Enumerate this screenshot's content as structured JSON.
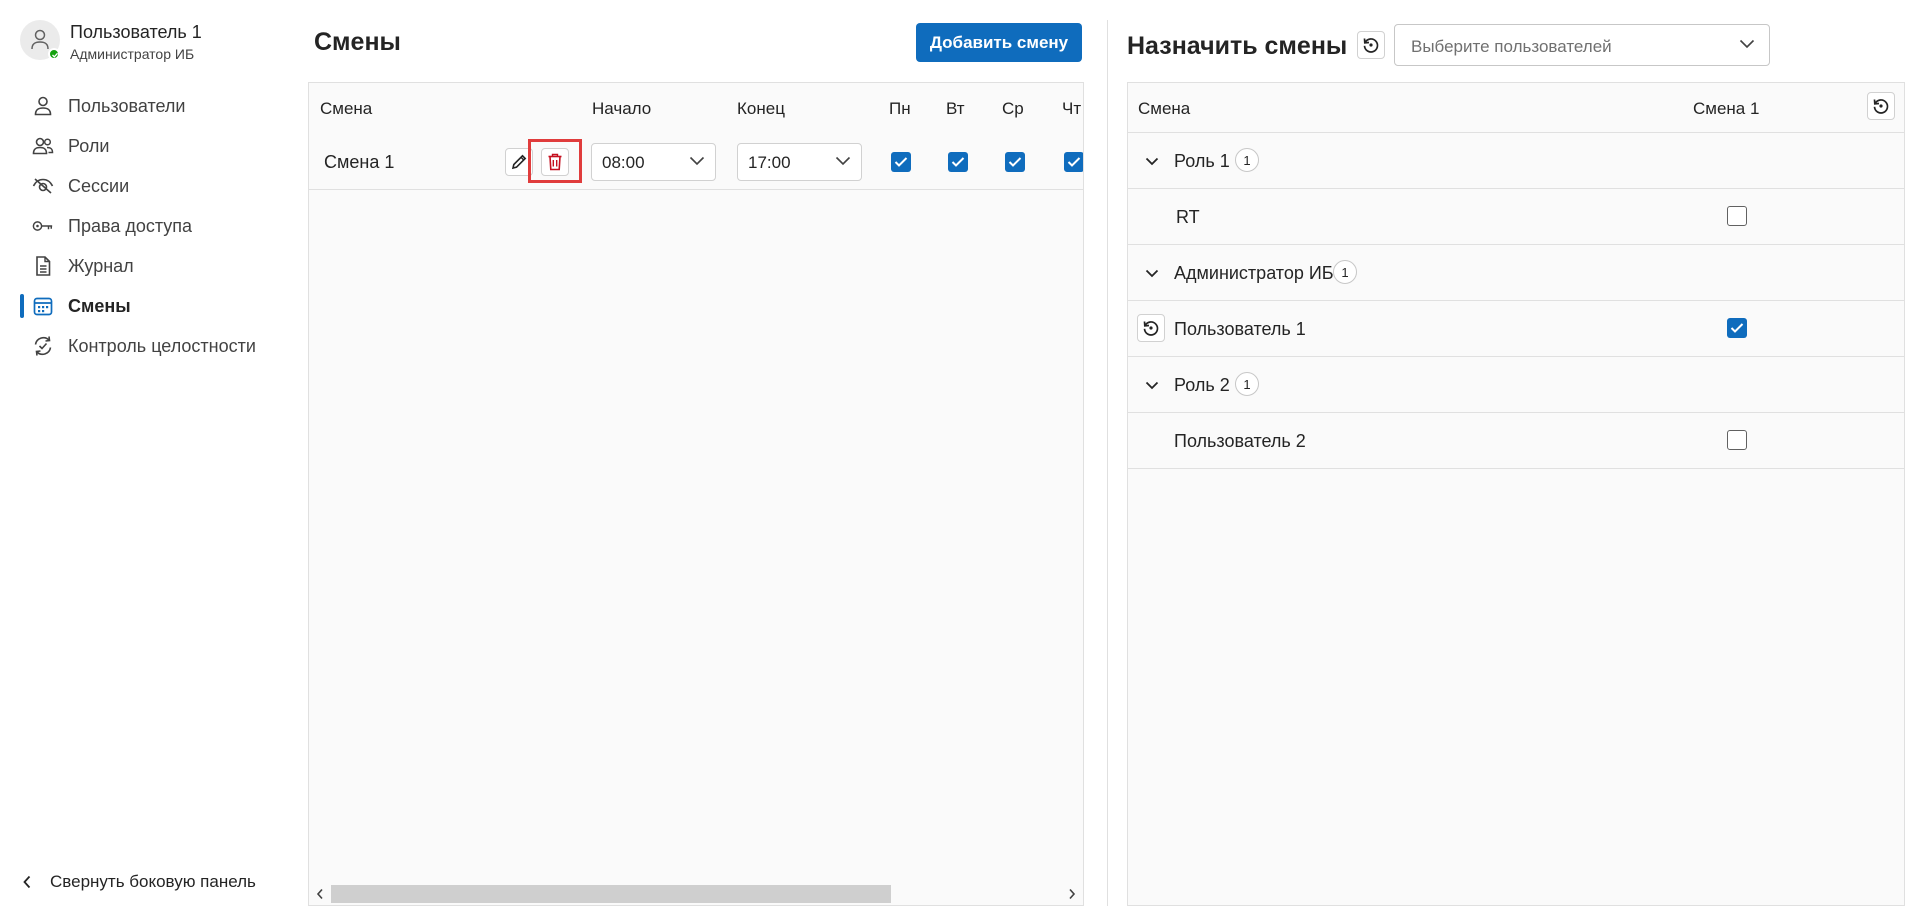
{
  "user": {
    "name": "Пользователь 1",
    "role": "Администратор ИБ"
  },
  "nav": [
    {
      "label": "Пользователи",
      "icon": "person-icon",
      "active": false
    },
    {
      "label": "Роли",
      "icon": "people-icon",
      "active": false
    },
    {
      "label": "Сессии",
      "icon": "eye-off-icon",
      "active": false
    },
    {
      "label": "Права доступа",
      "icon": "key-icon",
      "active": false
    },
    {
      "label": "Журнал",
      "icon": "document-icon",
      "active": false
    },
    {
      "label": "Смены",
      "icon": "calendar-icon",
      "active": true
    },
    {
      "label": "Контроль целостности",
      "icon": "sync-check-icon",
      "active": false
    }
  ],
  "collapse_label": "Свернуть боковую панель",
  "shifts": {
    "title": "Смены",
    "add_button": "Добавить смену",
    "columns": {
      "shift": "Смена",
      "start": "Начало",
      "end": "Конец",
      "mon": "Пн",
      "tue": "Вт",
      "wed": "Ср",
      "thu": "Чт"
    },
    "rows": [
      {
        "name": "Смена 1",
        "start": "08:00",
        "end": "17:00",
        "mon": true,
        "tue": true,
        "wed": true,
        "thu": true
      }
    ]
  },
  "assign": {
    "title": "Назначить смены",
    "user_select_placeholder": "Выберите пользователей",
    "columns": {
      "shift": "Смена",
      "shift1": "Смена 1"
    },
    "groups": [
      {
        "role": "Роль 1",
        "count": "1",
        "users": [
          {
            "name": "RT",
            "checked": false,
            "reset": false
          }
        ]
      },
      {
        "role": "Администратор ИБ",
        "count": "1",
        "users": [
          {
            "name": "Пользователь 1",
            "checked": true,
            "reset": true
          }
        ]
      },
      {
        "role": "Роль 2",
        "count": "1",
        "users": [
          {
            "name": "Пользователь 2",
            "checked": false,
            "reset": false
          }
        ]
      }
    ]
  },
  "colors": {
    "accent": "#0f6cbd",
    "danger": "#c50f1f",
    "highlight": "#e03c3c",
    "presence": "#13a10e"
  }
}
